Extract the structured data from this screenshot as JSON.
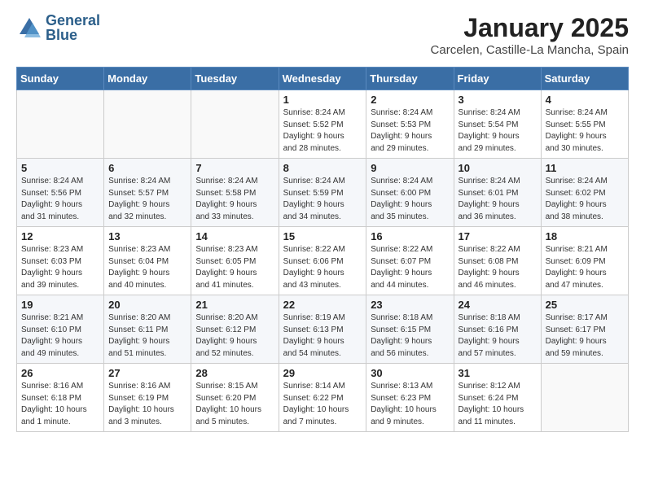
{
  "header": {
    "logo_general": "General",
    "logo_blue": "Blue",
    "month": "January 2025",
    "location": "Carcelen, Castille-La Mancha, Spain"
  },
  "days_of_week": [
    "Sunday",
    "Monday",
    "Tuesday",
    "Wednesday",
    "Thursday",
    "Friday",
    "Saturday"
  ],
  "weeks": [
    [
      {
        "day": "",
        "info": ""
      },
      {
        "day": "",
        "info": ""
      },
      {
        "day": "",
        "info": ""
      },
      {
        "day": "1",
        "info": "Sunrise: 8:24 AM\nSunset: 5:52 PM\nDaylight: 9 hours\nand 28 minutes."
      },
      {
        "day": "2",
        "info": "Sunrise: 8:24 AM\nSunset: 5:53 PM\nDaylight: 9 hours\nand 29 minutes."
      },
      {
        "day": "3",
        "info": "Sunrise: 8:24 AM\nSunset: 5:54 PM\nDaylight: 9 hours\nand 29 minutes."
      },
      {
        "day": "4",
        "info": "Sunrise: 8:24 AM\nSunset: 5:55 PM\nDaylight: 9 hours\nand 30 minutes."
      }
    ],
    [
      {
        "day": "5",
        "info": "Sunrise: 8:24 AM\nSunset: 5:56 PM\nDaylight: 9 hours\nand 31 minutes."
      },
      {
        "day": "6",
        "info": "Sunrise: 8:24 AM\nSunset: 5:57 PM\nDaylight: 9 hours\nand 32 minutes."
      },
      {
        "day": "7",
        "info": "Sunrise: 8:24 AM\nSunset: 5:58 PM\nDaylight: 9 hours\nand 33 minutes."
      },
      {
        "day": "8",
        "info": "Sunrise: 8:24 AM\nSunset: 5:59 PM\nDaylight: 9 hours\nand 34 minutes."
      },
      {
        "day": "9",
        "info": "Sunrise: 8:24 AM\nSunset: 6:00 PM\nDaylight: 9 hours\nand 35 minutes."
      },
      {
        "day": "10",
        "info": "Sunrise: 8:24 AM\nSunset: 6:01 PM\nDaylight: 9 hours\nand 36 minutes."
      },
      {
        "day": "11",
        "info": "Sunrise: 8:24 AM\nSunset: 6:02 PM\nDaylight: 9 hours\nand 38 minutes."
      }
    ],
    [
      {
        "day": "12",
        "info": "Sunrise: 8:23 AM\nSunset: 6:03 PM\nDaylight: 9 hours\nand 39 minutes."
      },
      {
        "day": "13",
        "info": "Sunrise: 8:23 AM\nSunset: 6:04 PM\nDaylight: 9 hours\nand 40 minutes."
      },
      {
        "day": "14",
        "info": "Sunrise: 8:23 AM\nSunset: 6:05 PM\nDaylight: 9 hours\nand 41 minutes."
      },
      {
        "day": "15",
        "info": "Sunrise: 8:22 AM\nSunset: 6:06 PM\nDaylight: 9 hours\nand 43 minutes."
      },
      {
        "day": "16",
        "info": "Sunrise: 8:22 AM\nSunset: 6:07 PM\nDaylight: 9 hours\nand 44 minutes."
      },
      {
        "day": "17",
        "info": "Sunrise: 8:22 AM\nSunset: 6:08 PM\nDaylight: 9 hours\nand 46 minutes."
      },
      {
        "day": "18",
        "info": "Sunrise: 8:21 AM\nSunset: 6:09 PM\nDaylight: 9 hours\nand 47 minutes."
      }
    ],
    [
      {
        "day": "19",
        "info": "Sunrise: 8:21 AM\nSunset: 6:10 PM\nDaylight: 9 hours\nand 49 minutes."
      },
      {
        "day": "20",
        "info": "Sunrise: 8:20 AM\nSunset: 6:11 PM\nDaylight: 9 hours\nand 51 minutes."
      },
      {
        "day": "21",
        "info": "Sunrise: 8:20 AM\nSunset: 6:12 PM\nDaylight: 9 hours\nand 52 minutes."
      },
      {
        "day": "22",
        "info": "Sunrise: 8:19 AM\nSunset: 6:13 PM\nDaylight: 9 hours\nand 54 minutes."
      },
      {
        "day": "23",
        "info": "Sunrise: 8:18 AM\nSunset: 6:15 PM\nDaylight: 9 hours\nand 56 minutes."
      },
      {
        "day": "24",
        "info": "Sunrise: 8:18 AM\nSunset: 6:16 PM\nDaylight: 9 hours\nand 57 minutes."
      },
      {
        "day": "25",
        "info": "Sunrise: 8:17 AM\nSunset: 6:17 PM\nDaylight: 9 hours\nand 59 minutes."
      }
    ],
    [
      {
        "day": "26",
        "info": "Sunrise: 8:16 AM\nSunset: 6:18 PM\nDaylight: 10 hours\nand 1 minute."
      },
      {
        "day": "27",
        "info": "Sunrise: 8:16 AM\nSunset: 6:19 PM\nDaylight: 10 hours\nand 3 minutes."
      },
      {
        "day": "28",
        "info": "Sunrise: 8:15 AM\nSunset: 6:20 PM\nDaylight: 10 hours\nand 5 minutes."
      },
      {
        "day": "29",
        "info": "Sunrise: 8:14 AM\nSunset: 6:22 PM\nDaylight: 10 hours\nand 7 minutes."
      },
      {
        "day": "30",
        "info": "Sunrise: 8:13 AM\nSunset: 6:23 PM\nDaylight: 10 hours\nand 9 minutes."
      },
      {
        "day": "31",
        "info": "Sunrise: 8:12 AM\nSunset: 6:24 PM\nDaylight: 10 hours\nand 11 minutes."
      },
      {
        "day": "",
        "info": ""
      }
    ]
  ]
}
